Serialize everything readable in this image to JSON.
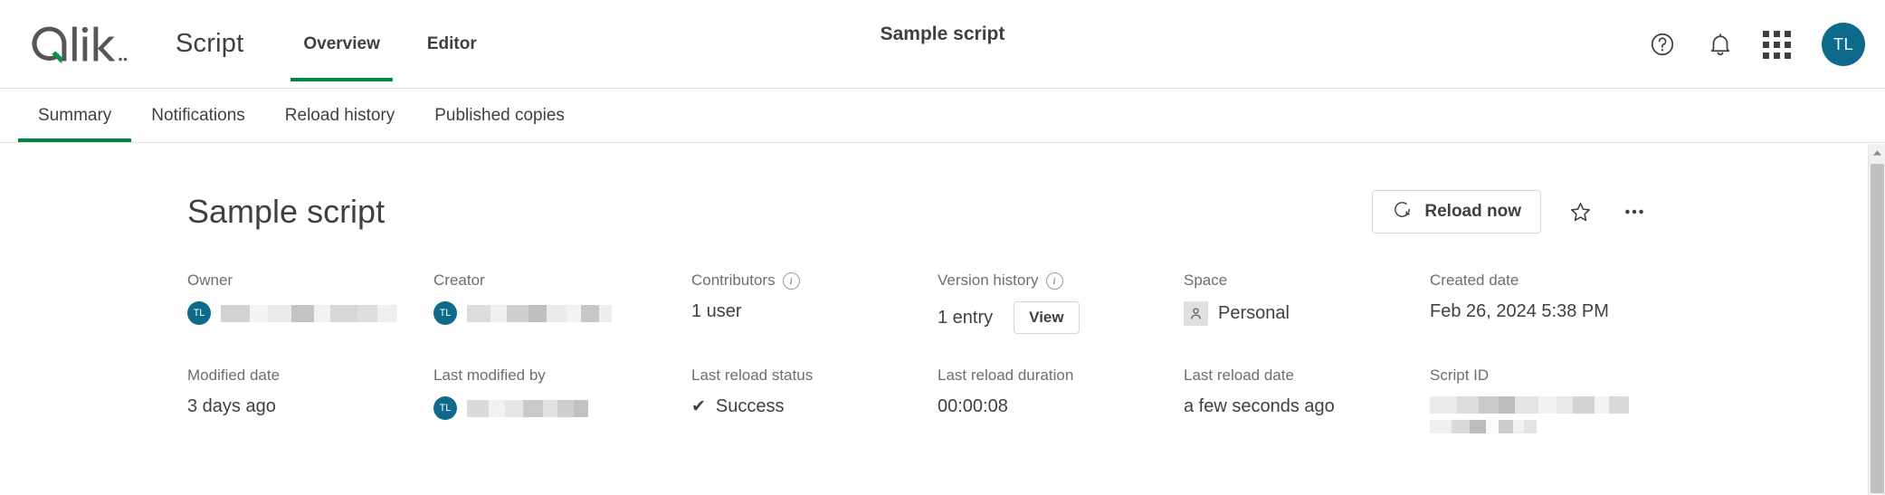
{
  "header": {
    "logo_alt": "Qlik",
    "app_name": "Script",
    "center_title": "Sample script",
    "tabs": [
      {
        "label": "Overview",
        "active": true
      },
      {
        "label": "Editor",
        "active": false
      }
    ],
    "actions": {
      "help": "?",
      "notifications": "bell-icon",
      "apps": "grid-icon",
      "avatar_initials": "TL"
    }
  },
  "subtabs": [
    {
      "label": "Summary",
      "active": true
    },
    {
      "label": "Notifications",
      "active": false
    },
    {
      "label": "Reload history",
      "active": false
    },
    {
      "label": "Published copies",
      "active": false
    }
  ],
  "page": {
    "title": "Sample script",
    "reload_button": "Reload now",
    "favorite_icon": "star-icon",
    "more_icon": "ellipsis-icon"
  },
  "metadata": [
    {
      "label": "Owner",
      "type": "user",
      "avatar_initials": "TL",
      "value": "",
      "redacted": true
    },
    {
      "label": "Creator",
      "type": "user",
      "avatar_initials": "TL",
      "value": "",
      "redacted": true
    },
    {
      "label": "Contributors",
      "type": "text",
      "info": true,
      "value": "1 user"
    },
    {
      "label": "Version history",
      "type": "version",
      "info": true,
      "value": "1 entry",
      "button": "View"
    },
    {
      "label": "Space",
      "type": "space",
      "value": "Personal"
    },
    {
      "label": "Created date",
      "type": "text",
      "value": "Feb 26, 2024 5:38 PM"
    },
    {
      "label": "Modified date",
      "type": "text",
      "value": "3 days ago"
    },
    {
      "label": "Last modified by",
      "type": "user",
      "avatar_initials": "TL",
      "value": "",
      "redacted": true
    },
    {
      "label": "Last reload status",
      "type": "status",
      "value": "Success",
      "status_icon": "check-icon"
    },
    {
      "label": "Last reload duration",
      "type": "text",
      "value": "00:00:08"
    },
    {
      "label": "Last reload date",
      "type": "text",
      "value": "a few seconds ago"
    },
    {
      "label": "Script ID",
      "type": "redacted-id",
      "value": "",
      "redacted": true
    }
  ],
  "colors": {
    "accent_green": "#00873d",
    "qlik_green": "#00a94f",
    "avatar_teal": "#0d6a8a",
    "text_primary": "#404040",
    "text_muted": "#6e6e6e",
    "border": "#e0e0e0"
  }
}
